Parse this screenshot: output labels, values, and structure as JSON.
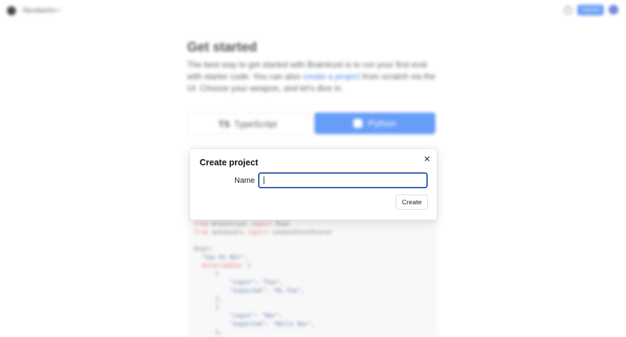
{
  "topbar": {
    "org_name": "Nicolasrtrn",
    "help_icon": "help-circle-icon",
    "upgrade_label": "Upgrade",
    "avatar_icon": "user-avatar"
  },
  "page": {
    "title": "Get started",
    "intro_before": "The best way to get started with Braintrust is to run your first eval with starter code. You can also ",
    "intro_link": "create a project",
    "intro_after": " from scratch via the UI. Choose your weapon, and let's dive in."
  },
  "languages": {
    "typescript_badge": "TS",
    "typescript_label": "TypeScript",
    "python_label": "Python",
    "selected": "Python"
  },
  "code": {
    "lines": [
      [
        {
          "t": "from",
          "c": "kw"
        },
        {
          "t": " braintrust ",
          "c": ""
        },
        {
          "t": "import",
          "c": "kw"
        },
        {
          "t": " Eval",
          "c": ""
        }
      ],
      [
        {
          "t": "from",
          "c": "kw"
        },
        {
          "t": " autoevals ",
          "c": ""
        },
        {
          "t": "import",
          "c": "kw"
        },
        {
          "t": " LevenshteinScorer",
          "c": ""
        }
      ],
      [],
      [
        {
          "t": "Eval(",
          "c": ""
        }
      ],
      [
        {
          "t": "  ",
          "c": ""
        },
        {
          "t": "\"Say Hi Bot\"",
          "c": "st"
        },
        {
          "t": ",",
          "c": ""
        }
      ],
      [
        {
          "t": "  ",
          "c": ""
        },
        {
          "t": "data=lambda",
          "c": "kw"
        },
        {
          "t": ": [",
          "c": ""
        }
      ],
      [
        {
          "t": "      {",
          "c": ""
        }
      ],
      [
        {
          "t": "          ",
          "c": ""
        },
        {
          "t": "\"input\"",
          "c": "st"
        },
        {
          "t": ": ",
          "c": ""
        },
        {
          "t": "\"Foo\"",
          "c": "st"
        },
        {
          "t": ",",
          "c": ""
        }
      ],
      [
        {
          "t": "          ",
          "c": ""
        },
        {
          "t": "\"expected\"",
          "c": "st"
        },
        {
          "t": ": ",
          "c": ""
        },
        {
          "t": "\"Hi Foo\"",
          "c": "st"
        },
        {
          "t": ",",
          "c": ""
        }
      ],
      [
        {
          "t": "      },",
          "c": ""
        }
      ],
      [
        {
          "t": "      {",
          "c": ""
        }
      ],
      [
        {
          "t": "          ",
          "c": ""
        },
        {
          "t": "\"input\"",
          "c": "st"
        },
        {
          "t": ": ",
          "c": ""
        },
        {
          "t": "\"Bar\"",
          "c": "st"
        },
        {
          "t": ",",
          "c": ""
        }
      ],
      [
        {
          "t": "          ",
          "c": ""
        },
        {
          "t": "\"expected\"",
          "c": "st"
        },
        {
          "t": ": ",
          "c": ""
        },
        {
          "t": "\"Hello Bar\"",
          "c": "st"
        },
        {
          "t": ",",
          "c": ""
        }
      ],
      [
        {
          "t": "      },",
          "c": ""
        }
      ]
    ]
  },
  "modal": {
    "title": "Create project",
    "close_icon": "close-icon",
    "name_label": "Name",
    "name_value": "",
    "create_label": "Create"
  },
  "colors": {
    "accent": "#3b82f6",
    "input_focus": "#2f5fb3",
    "link": "#2563eb"
  }
}
